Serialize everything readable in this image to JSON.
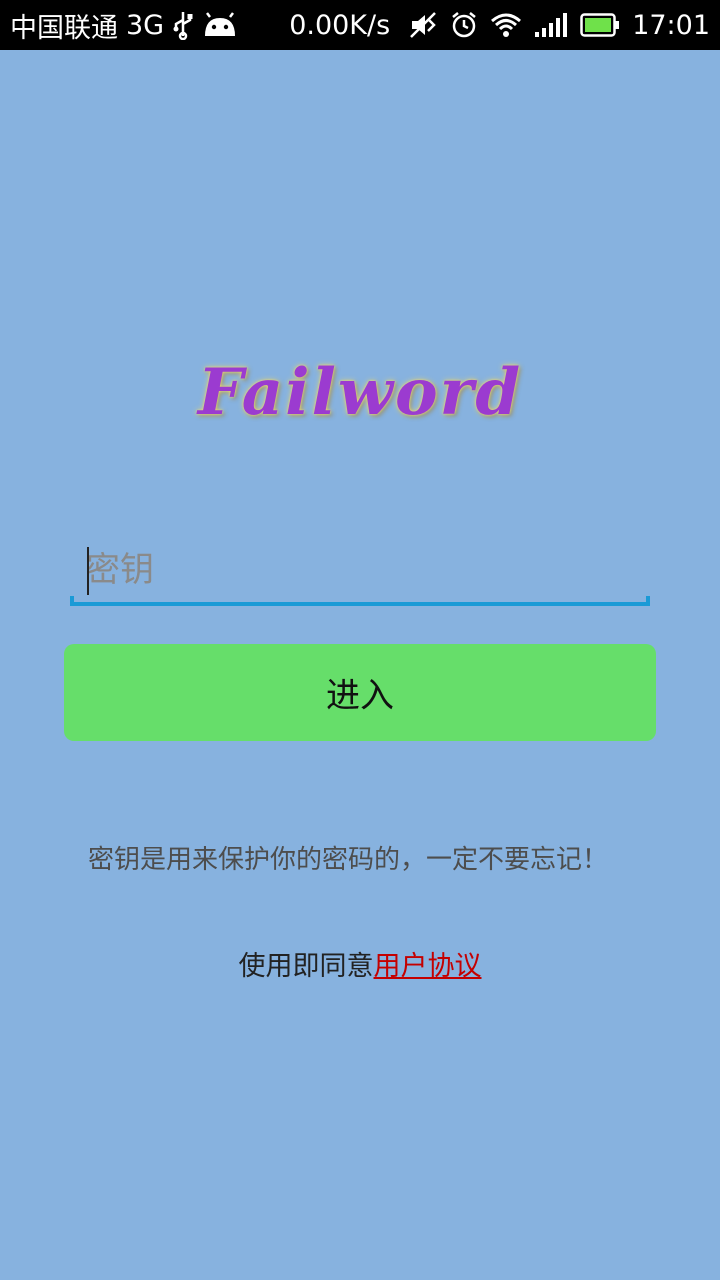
{
  "status_bar": {
    "carrier": "中国联通",
    "network": "3G",
    "speed": "0.00K/s",
    "time": "17:01",
    "icons": [
      "usb-icon",
      "android-icon",
      "mute-icon",
      "alarm-icon",
      "wifi-icon",
      "signal-icon",
      "battery-icon"
    ]
  },
  "app": {
    "logo_text": "Failword"
  },
  "form": {
    "key_placeholder": "密钥",
    "key_value": "",
    "enter_label": "进入"
  },
  "hint": "密钥是用来保护你的密码的，一定不要忘记！",
  "agreement": {
    "prefix": "使用即同意",
    "link_label": "用户协议"
  },
  "colors": {
    "background": "#87b2df",
    "logo": "#9b3bd0",
    "button": "#66de6a",
    "input_underline": "#1a9ad6",
    "link": "#c40000"
  }
}
